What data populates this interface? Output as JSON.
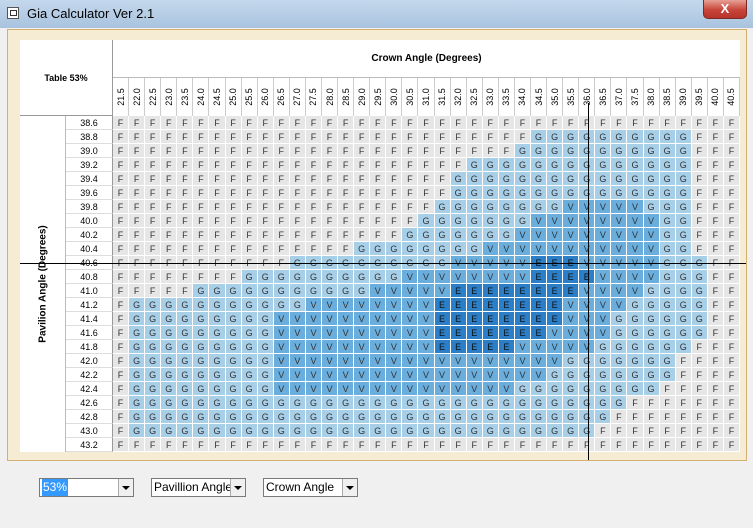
{
  "window": {
    "title": "Gia Calculator Ver 2.1",
    "close_label": "X"
  },
  "table_label": "Table 53%",
  "crown_header": "Crown Angle (Degrees)",
  "pavilion_header": "Pavilion Angle (Degrees)",
  "crown_angles": [
    "21.5",
    "22.0",
    "22.5",
    "23.0",
    "23.5",
    "24.0",
    "24.5",
    "25.0",
    "25.5",
    "26.0",
    "26.5",
    "27.0",
    "27.5",
    "28.0",
    "28.5",
    "29.0",
    "29.5",
    "30.0",
    "30.5",
    "31.0",
    "31.5",
    "32.0",
    "32.5",
    "33.0",
    "33.5",
    "34.0",
    "34.5",
    "35.0",
    "35.5",
    "36.0",
    "36.5",
    "37.0",
    "37.5",
    "38.0",
    "38.5",
    "39.0",
    "39.5",
    "40.0",
    "40.5"
  ],
  "pavilion_angles": [
    "38.6",
    "38.8",
    "39.0",
    "39.2",
    "39.4",
    "39.6",
    "39.8",
    "40.0",
    "40.2",
    "40.4",
    "40.6",
    "40.8",
    "41.0",
    "41.2",
    "41.4",
    "41.6",
    "41.8",
    "42.0",
    "42.2",
    "42.4",
    "42.6",
    "42.8",
    "43.0",
    "43.2"
  ],
  "grades": [
    "FFFFFFFFFFFFFFFFFFFFFFFFFFFFFFFFFFFFFFF",
    "FFFFFFFFFFFFFFFFFFFFFFFFFFGGGGGGGGGGFFF",
    "FFFFFFFFFFFFFFFFFFFFFFFFFGGGGGGGGGGGFFF",
    "FFFFFFFFFFFFFFFFFFFFFFGGGGGGGGGGGGGGFFF",
    "FFFFFFFFFFFFFFFFFFFFFGGGGGGGGGGGGGGGFFF",
    "FFFFFFFFFFFFFFFFFFFFFGGGGGGGGGGGGGGGFFF",
    "FFFFFFFFFFFFFFFFFFFFGGGGGGGGVVVVVGGGFFF",
    "FFFFFFFFFFFFFFFFFFFGGGGGGGVVVVVVVVGGFFF",
    "FFFFFFFFFFFFFFFFFFGGGGGGGVVVVVVVVVGGFFF",
    "FFFFFFFFFFFFFFFGGGGGGGGVVVVVVVVVVVGGFFF",
    "FFFFFFFFFFFGGGGGGGGGGVVVVVEEEVVVVVGGGFF",
    "FFFFFFFFGGGGGGGGGGVVVVVVVVEEEEVVVVGGGFF",
    "FFFFFGGGGGGGGGGGVVVVVEEEEEEEEVVVVGGGGFF",
    "FGGGGGGGGGGGVVVVVVVVEEEEEEEEVVVVGGGGGFF",
    "FGGGGGGGGGVVVVVVVVVVEEEEEEEEVVVGGGGGGFF",
    "FGGGGGGGGGVVVVVVVVVVEEEEEEEVVVVGGGGGGFF",
    "FGGGGGGGGGVVVVVVVVVVEEEEEVVVVVGGGGGGFFF",
    "FGGGGGGGGGVVVVVVVVVVVVVVVVVVGGGGGGGFFFF",
    "FGGGGGGGGGVVVVVVVVVVVVVVVVVGGGGGGGGFFFF",
    "FGGGGGGGGGVVVVVVVVVVVVVVVGGGGGGGGGFFFFF",
    "FGGGGGGGGGGGGGGGGGGGGGGGGGGGGGGGFFFFFFF",
    "FGGGGGGGGGGGGGGGGGGGGGGGGGGGGGGFFFFFFFF",
    "FGGGGGGGGGGGGGGGGGGGGGGGGGGGGGFFFFFFFFF",
    "FFFFFFFFFFFFFFFFFFFFFFFFFFFFFFFFFFFFFFF"
  ],
  "controls": {
    "table_select": "53%",
    "row_axis_select": "Pavillion Angle",
    "col_axis_select": "Crown Angle"
  },
  "colors": {
    "F": "#e6e6e6",
    "G": "#a8cfe8",
    "V": "#6aaede",
    "E": "#2a7fc8"
  }
}
